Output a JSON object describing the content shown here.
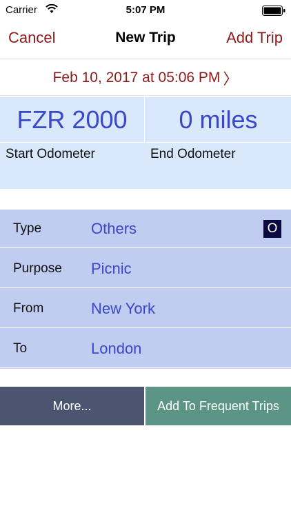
{
  "status_bar": {
    "carrier": "Carrier",
    "time": "5:07 PM",
    "wifi_icon": "wifi-icon",
    "battery_icon": "battery-full-icon"
  },
  "nav": {
    "cancel_label": "Cancel",
    "title": "New Trip",
    "add_label": "Add Trip"
  },
  "trip_date": {
    "value": "Feb 10, 2017 at 05:06 PM",
    "chevron": "〉"
  },
  "odometer": {
    "start_value": "FZR 2000",
    "end_value": "0 miles",
    "start_label": "Start Odometer",
    "end_label": "End Odometer"
  },
  "details": [
    {
      "label": "Type",
      "value": "Others",
      "badge": "O"
    },
    {
      "label": "Purpose",
      "value": "Picnic"
    },
    {
      "label": "From",
      "value": "New York"
    },
    {
      "label": "To",
      "value": "London"
    }
  ],
  "actions": {
    "more_label": "More...",
    "frequent_label": "Add To Frequent Trips"
  },
  "colors": {
    "accent_red": "#8b1a1a",
    "value_blue": "#3a47c8",
    "odometer_bg": "#d9e8fb",
    "details_bg": "#c0ccf0",
    "more_button_bg": "#4a5570",
    "frequent_button_bg": "#5c9486"
  }
}
